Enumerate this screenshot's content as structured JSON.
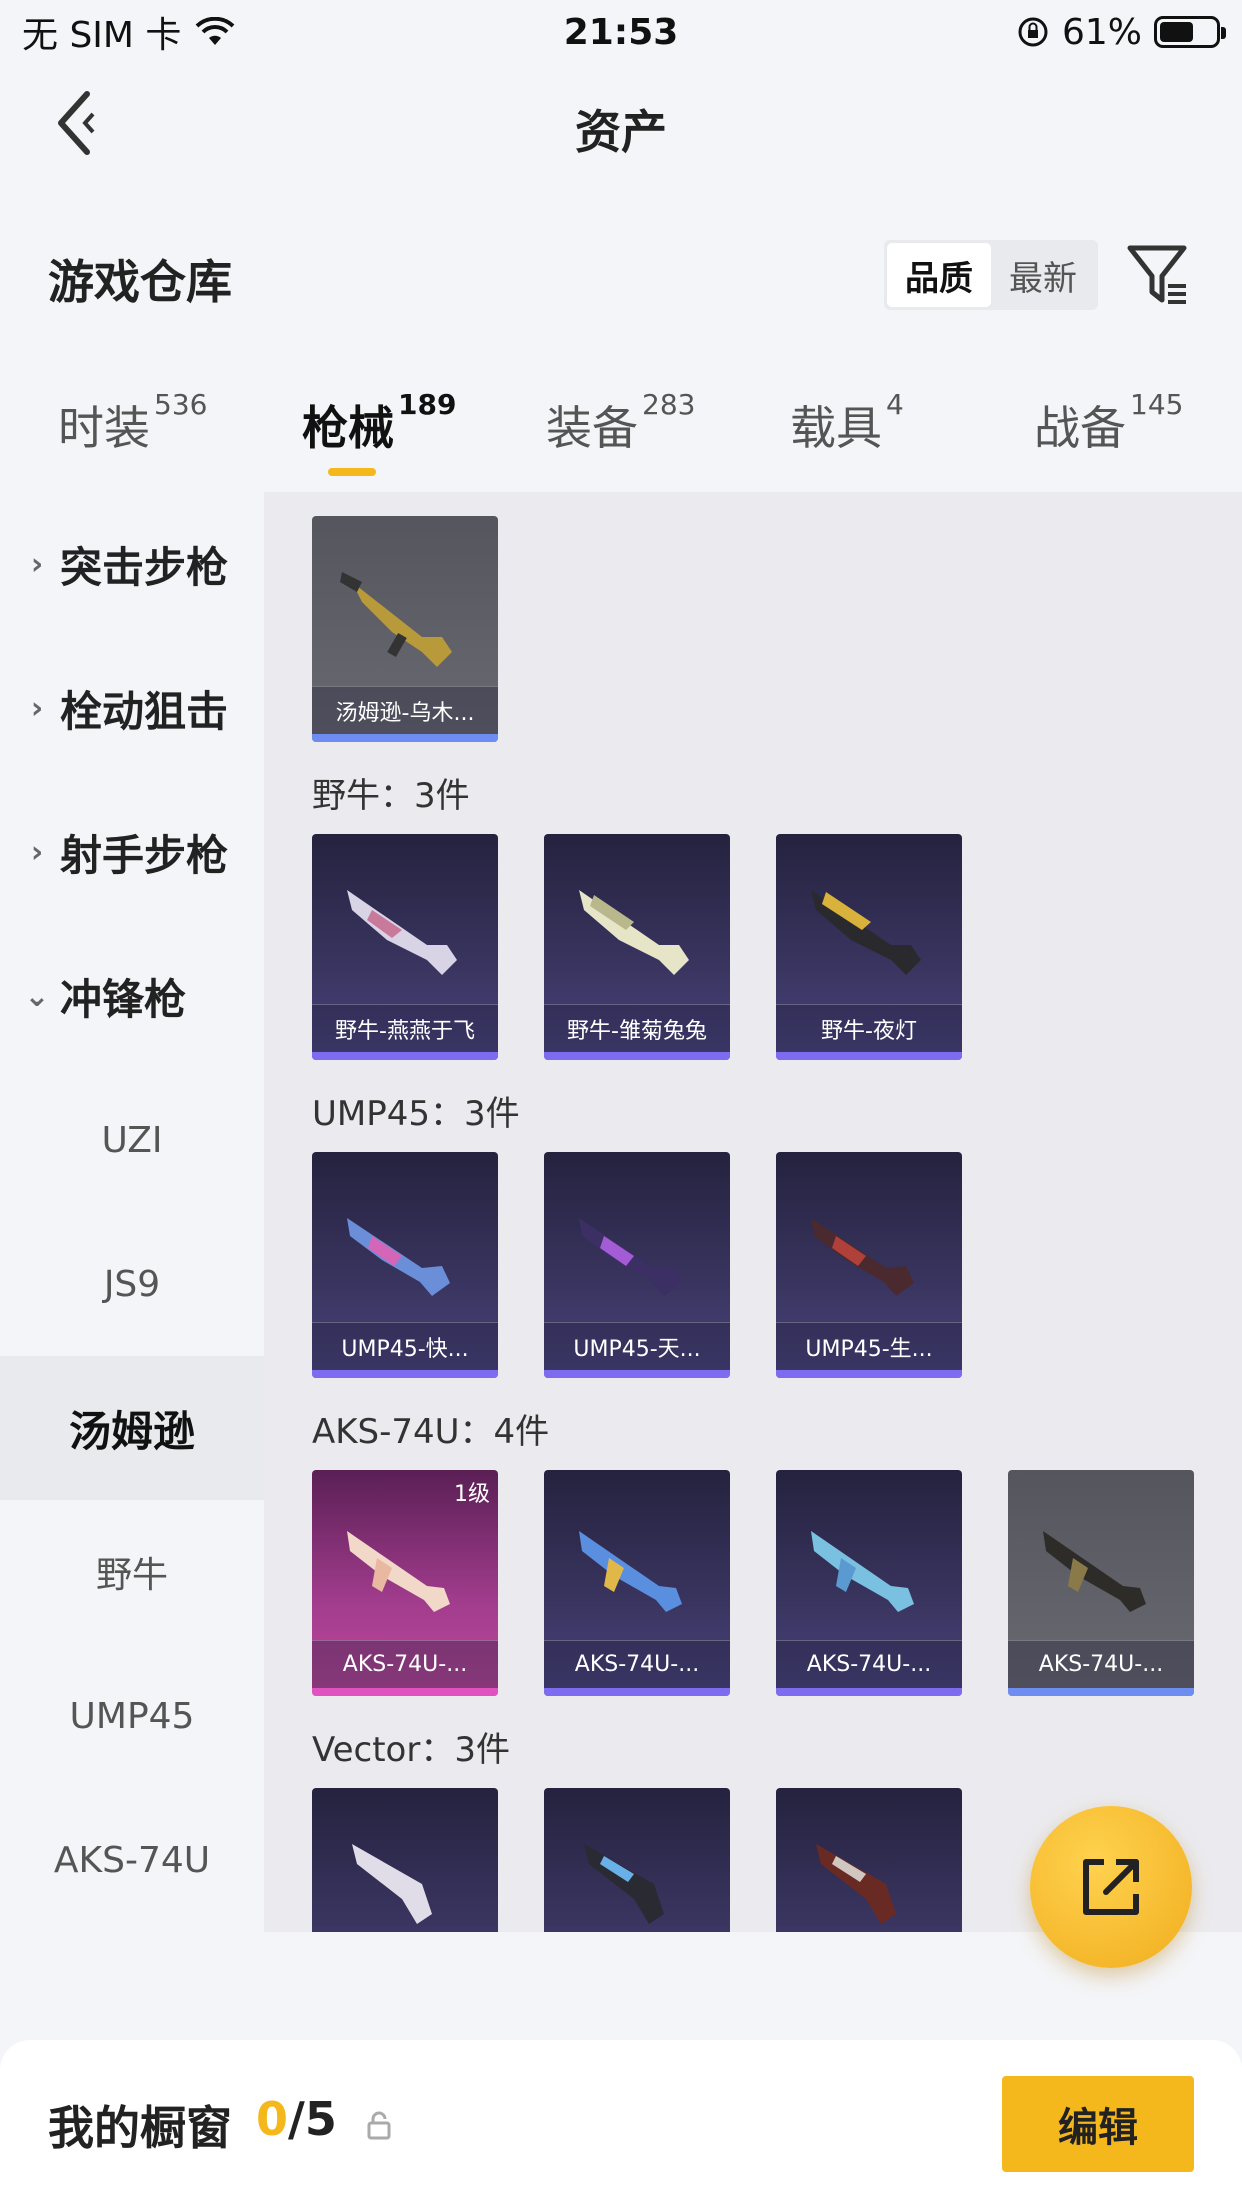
{
  "status_bar": {
    "carrier": "无 SIM 卡",
    "time": "21:53",
    "battery": "61%",
    "battery_level": 0.61
  },
  "nav": {
    "title": "资产"
  },
  "warehouse": {
    "title": "游戏仓库",
    "sort_options": [
      "品质",
      "最新"
    ],
    "sort_selected": "品质"
  },
  "tabs": [
    {
      "label": "时装",
      "count": "536"
    },
    {
      "label": "枪械",
      "count": "189"
    },
    {
      "label": "装备",
      "count": "283"
    },
    {
      "label": "载具",
      "count": "4"
    },
    {
      "label": "战备",
      "count": "145"
    }
  ],
  "active_tab": "枪械",
  "sidebar": {
    "groups": [
      {
        "label": "突击步枪",
        "expanded": false
      },
      {
        "label": "栓动狙击",
        "expanded": false
      },
      {
        "label": "射手步枪",
        "expanded": false
      },
      {
        "label": "冲锋枪",
        "expanded": true
      }
    ],
    "subitems": [
      "UZI",
      "JS9",
      "汤姆逊",
      "野牛",
      "UMP45",
      "AKS-74U"
    ],
    "selected": "汤姆逊"
  },
  "sections": [
    {
      "label": "",
      "items": [
        {
          "name": "汤姆逊-乌木...",
          "quality": "grey"
        }
      ]
    },
    {
      "label": "野牛：3件",
      "items": [
        {
          "name": "野牛-燕燕于飞",
          "quality": "purple"
        },
        {
          "name": "野牛-雏菊兔兔",
          "quality": "purple"
        },
        {
          "name": "野牛-夜灯",
          "quality": "purple"
        }
      ]
    },
    {
      "label": "UMP45：3件",
      "items": [
        {
          "name": "UMP45-快...",
          "quality": "purple"
        },
        {
          "name": "UMP45-天...",
          "quality": "purple"
        },
        {
          "name": "UMP45-生...",
          "quality": "purple"
        }
      ]
    },
    {
      "label": "AKS-74U：4件",
      "items": [
        {
          "name": "AKS-74U-...",
          "quality": "pink",
          "level": "1级"
        },
        {
          "name": "AKS-74U-...",
          "quality": "purple"
        },
        {
          "name": "AKS-74U-...",
          "quality": "purple"
        },
        {
          "name": "AKS-74U-...",
          "quality": "grey"
        }
      ]
    },
    {
      "label": "Vector：3件",
      "items": [
        {
          "name": "",
          "quality": "purple"
        },
        {
          "name": "",
          "quality": "purple"
        },
        {
          "name": "",
          "quality": "purple"
        }
      ]
    }
  ],
  "showcase": {
    "title": "我的橱窗",
    "current": "0",
    "separator": "/",
    "max": "5",
    "edit_label": "编辑"
  },
  "colors": {
    "accent": "#f5b81c",
    "purple_card": "#3a3560",
    "grey_card": "#6a6a73",
    "pink_card": "#a33d8e"
  },
  "icons": {
    "back": "chevron-left-icon",
    "filter": "filter-icon",
    "share": "share-icon",
    "lock": "lock-icon",
    "wifi": "wifi-icon",
    "rotation_lock": "rotation-lock-icon"
  }
}
